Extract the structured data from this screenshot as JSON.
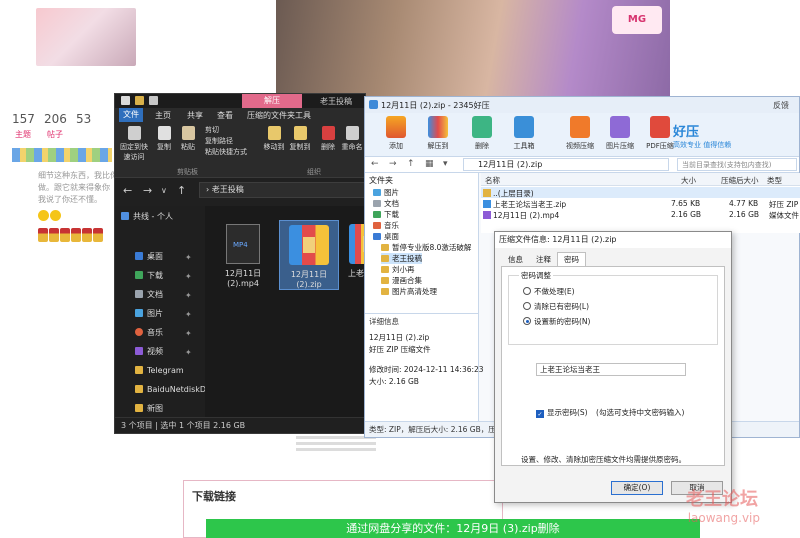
{
  "forum": {
    "stats": [
      {
        "num": "157",
        "label": "主题"
      },
      {
        "num": "206",
        "label": "帖子"
      },
      {
        "num": "53",
        "label": ""
      }
    ],
    "snippet": [
      "细节这种东西，我比你",
      "做。跟它就来得象你",
      "我说了你还不懂。"
    ],
    "video_badge": "MG",
    "download_title": "下载链接",
    "download_link": "通过网盘分享的文件：12月9日 (3).zip删除",
    "watermark_cn": "老王论坛",
    "watermark_en": "laowang.vip"
  },
  "explorer": {
    "ribbon_tab_highlight": "解压",
    "title": "老王投稿",
    "tabs": [
      "文件",
      "主页",
      "共享",
      "查看",
      "压缩的文件夹工具"
    ],
    "ribbon_buttons": [
      {
        "label": "固定到快速访问",
        "icon": "pin-icon"
      },
      {
        "label": "复制",
        "icon": "copy-icon"
      },
      {
        "label": "粘贴",
        "icon": "paste-icon"
      },
      {
        "label": "移动到",
        "icon": "move-icon"
      },
      {
        "label": "复制到",
        "icon": "copy-to-icon"
      },
      {
        "label": "删除",
        "icon": "delete-icon"
      },
      {
        "label": "重命名",
        "icon": "rename-icon"
      }
    ],
    "ribbon_small": [
      "剪切",
      "复制路径",
      "粘贴快捷方式"
    ],
    "ribbon_groups": [
      "剪贴板",
      "组织"
    ],
    "path": "老王投稿",
    "sidebar": [
      {
        "label": "共线 - 个人",
        "icon": "cloud-icon",
        "pinned": false
      },
      {
        "label": "桌面",
        "icon": "desktop-icon",
        "pinned": true
      },
      {
        "label": "下载",
        "icon": "download-icon",
        "pinned": true
      },
      {
        "label": "文档",
        "icon": "document-icon",
        "pinned": true
      },
      {
        "label": "图片",
        "icon": "picture-icon",
        "pinned": true
      },
      {
        "label": "音乐",
        "icon": "music-icon",
        "pinned": true
      },
      {
        "label": "视频",
        "icon": "video-icon",
        "pinned": true
      },
      {
        "label": "Telegram",
        "icon": "folder-icon",
        "pinned": false
      },
      {
        "label": "BaiduNetdiskD",
        "icon": "folder-icon",
        "pinned": false
      },
      {
        "label": "新图",
        "icon": "folder-icon",
        "pinned": false
      }
    ],
    "files": [
      {
        "name": "12月11日 (2).mp4",
        "type": "MP4"
      },
      {
        "name": "12月11日 (2).zip",
        "type": "zip"
      },
      {
        "name": "上老",
        "type": "zip"
      }
    ],
    "status": "3 个项目  |  选中 1 个项目  2.16 GB"
  },
  "zip": {
    "title": "12月11日 (2).zip - 2345好压",
    "title_right": "反馈",
    "toolbar": [
      "添加",
      "解压到",
      "删除",
      "工具箱",
      "视频压缩",
      "图片压缩",
      "PDF压缩"
    ],
    "brand": "好压",
    "brand_sub": "高效专业  值得信赖",
    "path": "12月11日 (2).zip",
    "search_placeholder": "当前目录查找(支持包内查找)",
    "tree_head": "文件夹",
    "tree": [
      {
        "label": "图片",
        "level": 1
      },
      {
        "label": "文档",
        "level": 1
      },
      {
        "label": "下载",
        "level": 1
      },
      {
        "label": "音乐",
        "level": 1
      },
      {
        "label": "桌面",
        "level": 1
      },
      {
        "label": "暂停专业版8.0激活破解",
        "level": 2
      },
      {
        "label": "老王投稿",
        "level": 2,
        "selected": true
      },
      {
        "label": "刘小再",
        "level": 2
      },
      {
        "label": "漫画合集",
        "level": 2
      },
      {
        "label": "图片高清处理",
        "level": 2
      }
    ],
    "columns": [
      "名称",
      "大小",
      "压缩后大小",
      "类型"
    ],
    "rows": [
      {
        "name": "..(上层目录)",
        "size": "",
        "packed": "",
        "type": ""
      },
      {
        "name": "上老王论坛当老王.zip",
        "size": "7.65 KB",
        "packed": "4.77 KB",
        "type": "好压 ZIP 压"
      },
      {
        "name": "12月11日 (2).mp4",
        "size": "2.16 GB",
        "packed": "2.16 GB",
        "type": "媒体文件 (.m"
      }
    ],
    "detail_head": "详细信息",
    "detail": [
      "12月11日 (2).zip",
      "好压 ZIP 压缩文件",
      "修改时间: 2024-12-11 14:36:23",
      "大小: 2.16 GB"
    ],
    "status": "类型: ZIP，解压后大小: 2.16 GB，压缩"
  },
  "dialog": {
    "title": "压缩文件信息: 12月11日 (2).zip",
    "tabs": [
      "信息",
      "注释",
      "密码"
    ],
    "group": "密码调整",
    "options": [
      {
        "label": "不做处理(E)",
        "checked": false
      },
      {
        "label": "清除已有密码(L)",
        "checked": false
      },
      {
        "label": "设置新的密码(N)",
        "checked": true
      }
    ],
    "password": "上老王论坛当老王",
    "show_password": "显示密码(S)",
    "show_password_hint": "(勾选可支持中文密码输入)",
    "hint": "设置、修改、清除加密压缩文件均需提供原密码。",
    "ok": "确定(O)",
    "cancel": "取消"
  }
}
